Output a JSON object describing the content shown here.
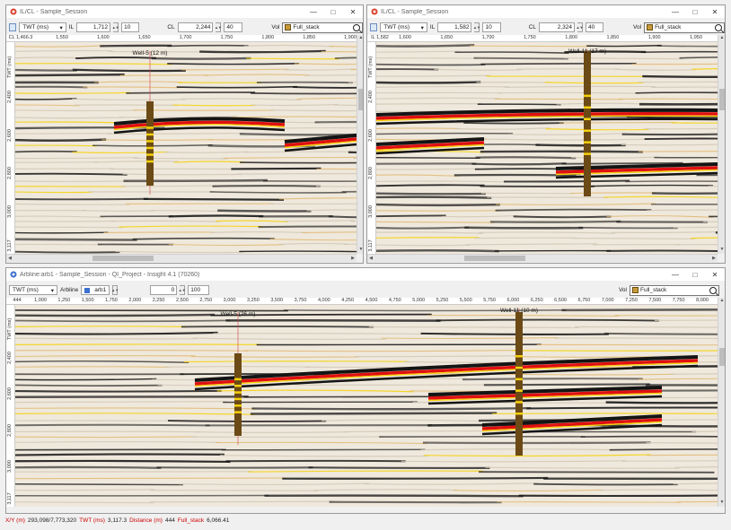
{
  "windows": {
    "left": {
      "title": "IL/CL - Sample_Session",
      "time_mode": "TWT (ms)",
      "il_label": "IL",
      "il_value": "1,712",
      "il_step": "10",
      "cl_label": "CL",
      "cl_value": "2,244",
      "cl_step": "40",
      "vol_label": "Vol",
      "vol_value": "Full_stack",
      "corner_label": "CL 1,466.3",
      "x_ticks": [
        "1,550",
        "1,600",
        "1,650",
        "1,700",
        "1,750",
        "1,800",
        "1,850",
        "1,900"
      ],
      "y_ticks": [
        "TWT (ms)",
        "2,400",
        "2,600",
        "2,800",
        "3,000",
        "3,117"
      ],
      "wells": [
        {
          "label": "Well-5 (12 m)"
        }
      ]
    },
    "right": {
      "title": "IL/CL - Sample_Session",
      "time_mode": "TWT (ms)",
      "il_label": "IL",
      "il_value": "1,582",
      "il_step": "10",
      "cl_label": "CL",
      "cl_value": "2,324",
      "cl_step": "40",
      "vol_label": "Vol",
      "vol_value": "Full_stack",
      "corner_label": "IL 1,582",
      "x_ticks": [
        "1,600",
        "1,650",
        "1,700",
        "1,750",
        "1,800",
        "1,850",
        "1,900",
        "1,950"
      ],
      "y_ticks": [
        "TWT (ms)",
        "2,400",
        "2,600",
        "2,800",
        "3,000",
        "3,117"
      ],
      "wells": [
        {
          "label": "Well-11 (17 m)"
        }
      ]
    },
    "bottom": {
      "title": "Arbline:arb1 - Sample_Session - QI_Project - Insight 4.1 (70260)",
      "time_mode": "TWT (ms)",
      "arbline_label": "Arbline",
      "arbline_value": "arb1",
      "start_value": "0",
      "step_value": "100",
      "vol_label": "Vol",
      "vol_value": "Full_stack",
      "corner_label": "444",
      "x_ticks": [
        "1,000",
        "1,250",
        "1,500",
        "1,750",
        "2,000",
        "2,250",
        "2,500",
        "2,750",
        "3,000",
        "3,250",
        "3,500",
        "3,750",
        "4,000",
        "4,250",
        "4,500",
        "4,750",
        "5,000",
        "5,250",
        "5,500",
        "5,750",
        "6,000",
        "6,250",
        "6,500",
        "6,750",
        "7,000",
        "7,250",
        "7,500",
        "7,750",
        "8,000"
      ],
      "y_ticks": [
        "TWT (ms)",
        "2,400",
        "2,600",
        "2,800",
        "3,000",
        "3,117"
      ],
      "wells": [
        {
          "label": "Well-5 (26 m)"
        },
        {
          "label": "Well-11 (10 m)"
        }
      ]
    }
  },
  "status": {
    "xy_label": "X/Y (m)",
    "xy_value": "293,098/7,773,320",
    "twt_label": "TWT (ms)",
    "twt_value": "3,117.3",
    "dist_label": "Distance (m)",
    "dist_value": "444",
    "vol_label": "Full_stack",
    "vol_value": "6,066.41"
  },
  "colors": {
    "red_horizon": "#e01010",
    "yellow_horizon": "#f5d20a",
    "well_log": "#6b4a16",
    "black_trough": "#141414"
  }
}
